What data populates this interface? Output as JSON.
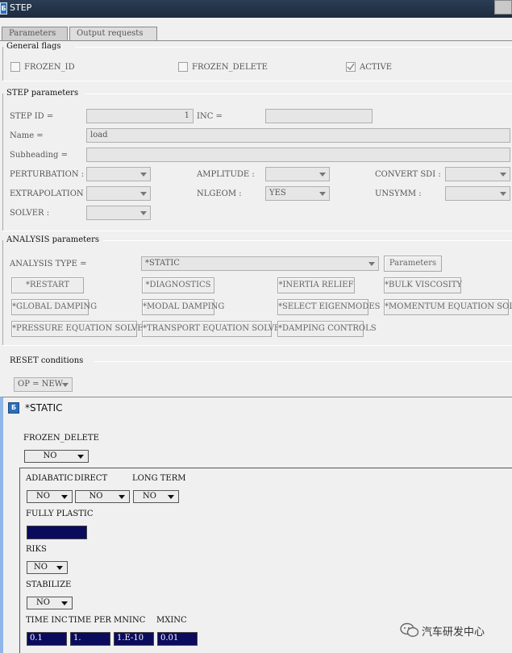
{
  "window": {
    "title": "STEP",
    "app_icon": "ansa-logo-icon"
  },
  "tabs": [
    {
      "label": "Parameters",
      "active": true
    },
    {
      "label": "Output requests",
      "active": false
    }
  ],
  "general_flags": {
    "title": "General flags",
    "frozen_id": "FROZEN_ID",
    "frozen_delete": "FROZEN_DELETE",
    "active": "ACTIVE"
  },
  "step_parameters": {
    "title": "STEP parameters",
    "step_id_label": "STEP ID =",
    "step_id_value": "1",
    "inc_label": "INC =",
    "inc_value": "",
    "name_label": "Name =",
    "name_value": "load",
    "subheading_label": "Subheading =",
    "subheading_value": "",
    "perturbation_label": "PERTURBATION :",
    "perturbation_value": "",
    "amplitude_label": "AMPLITUDE :",
    "amplitude_value": "",
    "convert_sdi_label": "CONVERT SDI :",
    "convert_sdi_value": "",
    "extrapolation_label": "EXTRAPOLATION :",
    "extrapolation_value": "",
    "nlgeom_label": "NLGEOM :",
    "nlgeom_value": "YES",
    "unsymm_label": "UNSYMM :",
    "unsymm_value": "",
    "solver_label": "SOLVER :",
    "solver_value": ""
  },
  "analysis": {
    "title": "ANALYSIS parameters",
    "type_label": "ANALYSIS TYPE =",
    "type_value": "*STATIC",
    "parameters_button": "Parameters",
    "buttons": [
      "*RESTART",
      "*DIAGNOSTICS",
      "*INERTIA RELIEF",
      "*BULK VISCOSITY",
      "*GLOBAL DAMPING",
      "*MODAL DAMPING",
      "*SELECT EIGENMODES",
      "*MOMENTUM EQUATION SOLVER",
      "*PRESSURE EQUATION SOLVER",
      "*TRANSPORT EQUATION SOLVER",
      "*DAMPING CONTROLS"
    ]
  },
  "reset": {
    "title": "RESET conditions",
    "op_value": "OP = NEW"
  },
  "static_window": {
    "title": "*STATIC",
    "frozen_delete_label": "FROZEN_DELETE",
    "frozen_delete_value": "NO",
    "adiabatic_label": "ADIABATIC",
    "direct_label": "DIRECT",
    "long_term_label": "LONG TERM",
    "adiabatic_value": "NO",
    "direct_value": "NO",
    "long_term_value": "NO",
    "fully_plastic_label": "FULLY PLASTIC",
    "fully_plastic_value": "",
    "riks_label": "RIKS",
    "riks_value": "NO",
    "stabilize_label": "STABILIZE",
    "stabilize_value": "NO",
    "time_inc_label": "TIME INC",
    "time_per_label": "TIME PER",
    "mninc_label": "MNINC",
    "mxinc_label": "MXINC",
    "time_inc_value": "0.1",
    "time_per_value": "1.",
    "mninc_value": "1.E-10",
    "mxinc_value": "0.01"
  },
  "watermark": {
    "text": "汽车研发中心",
    "icon": "wechat-icon"
  }
}
